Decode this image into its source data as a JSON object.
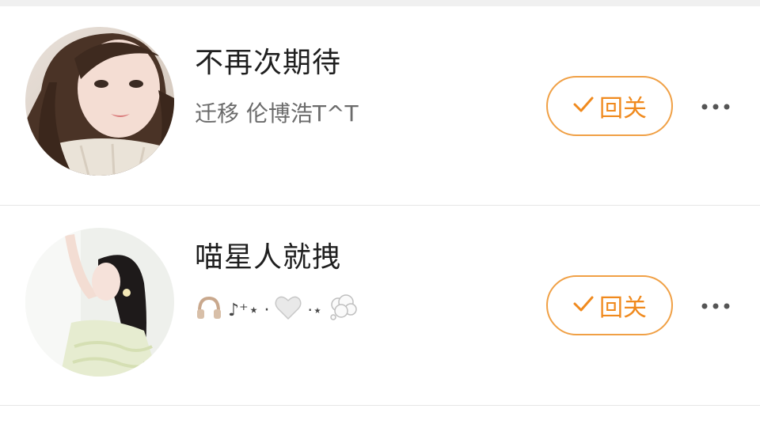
{
  "users": [
    {
      "username": "不再次期待",
      "bio": "迁移 伦博浩T^T",
      "follow_label": "回关",
      "avatar_icon": "avatar-photo-woman-long-hair"
    },
    {
      "username": "喵星人就拽",
      "bio_symbols": [
        "🎧",
        "♪⁺⋆",
        "·",
        "🤍",
        "·⋆",
        "💭"
      ],
      "follow_label": "回关",
      "avatar_icon": "avatar-photo-woman-white-dress"
    }
  ],
  "colors": {
    "accent": "#f08a1e",
    "accent_border": "#f0a045",
    "username": "#1f1f1f",
    "bio": "#6b6b6b",
    "divider": "#e6e6e6"
  },
  "icons": {
    "check": "check-icon",
    "more": "more-horizontal-icon"
  }
}
